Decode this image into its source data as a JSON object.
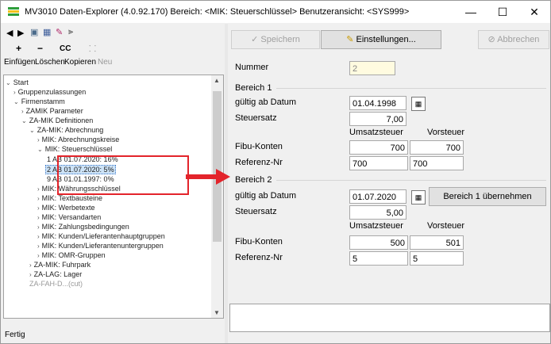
{
  "window": {
    "title": "MV3010 Daten-Explorer (4.0.92.170)  Bereich: <MIK: Steuerschlüssel>   Benutzeransicht: <SYS999>",
    "minimize": "—",
    "maximize": "☐",
    "close": "✕"
  },
  "toolbar": {
    "insert_label": "Einfügen",
    "delete_label": "Löschen",
    "copy_label": "Kopieren",
    "new_label": "Neu",
    "insert_symbol": "+",
    "delete_symbol": "−",
    "copy_symbol": "CC"
  },
  "tree": {
    "items": [
      {
        "label": "Start",
        "arrow": "v"
      },
      {
        "label": "Gruppenzulassungen",
        "arrow": ">"
      },
      {
        "label": "Firmenstamm",
        "arrow": "v"
      },
      {
        "label": "ZAMIK Parameter",
        "arrow": ">"
      },
      {
        "label": "ZA-MIK Definitionen",
        "arrow": "v"
      },
      {
        "label": "ZA-MIK: Abrechnung",
        "arrow": "v"
      },
      {
        "label": "MIK: Abrechnungskreise",
        "arrow": ">"
      },
      {
        "label": "MIK: Steuerschlüssel",
        "arrow": "v"
      },
      {
        "label": "1 AB 01.07.2020: 16%",
        "arrow": ""
      },
      {
        "label": "2 AB 01.07.2020: 5%",
        "arrow": ""
      },
      {
        "label": "9 AB 01.01.1997: 0%",
        "arrow": ""
      },
      {
        "label": "MIK: Währungsschlüssel",
        "arrow": ">"
      },
      {
        "label": "MIK: Textbausteine",
        "arrow": ">"
      },
      {
        "label": "MIK: Werbetexte",
        "arrow": ">"
      },
      {
        "label": "MIK: Versandarten",
        "arrow": ">"
      },
      {
        "label": "MIK: Zahlungsbedingungen",
        "arrow": ">"
      },
      {
        "label": "MIK: Kunden/Lieferantenhauptgruppen",
        "arrow": ">"
      },
      {
        "label": "MIK: Kunden/Lieferantenuntergruppen",
        "arrow": ">"
      },
      {
        "label": "MIK: OMR-Gruppen",
        "arrow": ">"
      },
      {
        "label": "ZA-MIK: Fuhrpark",
        "arrow": ">"
      },
      {
        "label": "ZA-LAG: Lager",
        "arrow": ">"
      },
      {
        "label": "ZA-FAH-D...(cut)",
        "arrow": ""
      }
    ]
  },
  "status": {
    "text": "Fertig"
  },
  "buttons": {
    "save": "Speichern",
    "settings": "Einstellungen...",
    "cancel": "Abbrechen",
    "copy_bereich1": "Bereich 1 übernehmen"
  },
  "form": {
    "nummer_label": "Nummer",
    "nummer_value": "2",
    "bereich1": {
      "title": "Bereich 1",
      "gueltig_label": "gültig ab Datum",
      "gueltig_value": "01.04.1998",
      "steuersatz_label": "Steuersatz",
      "steuersatz_value": "7,00",
      "umsatzsteuer_header": "Umsatzsteuer",
      "vorsteuer_header": "Vorsteuer",
      "fibu_label": "Fibu-Konten",
      "fibu_ust": "700",
      "fibu_vst": "700",
      "ref_label": "Referenz-Nr",
      "ref_ust": "700",
      "ref_vst": "700"
    },
    "bereich2": {
      "title": "Bereich 2",
      "gueltig_label": "gültig ab Datum",
      "gueltig_value": "01.07.2020",
      "steuersatz_label": "Steuersatz",
      "steuersatz_value": "5,00",
      "umsatzsteuer_header": "Umsatzsteuer",
      "vorsteuer_header": "Vorsteuer",
      "fibu_label": "Fibu-Konten",
      "fibu_ust": "500",
      "fibu_vst": "501",
      "ref_label": "Referenz-Nr",
      "ref_ust": "5",
      "ref_vst": "5"
    }
  },
  "colors": {
    "highlight": "#e3242b",
    "accent": "#2f9e2f"
  }
}
